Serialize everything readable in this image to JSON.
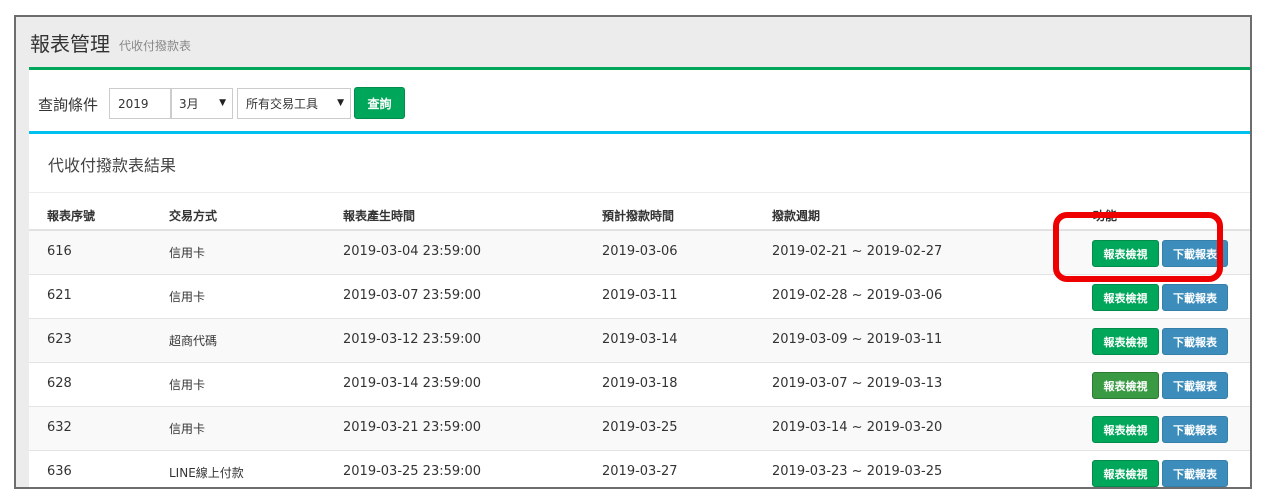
{
  "header": {
    "title": "報表管理",
    "subtitle": "代收付撥款表"
  },
  "query": {
    "label": "查詢條件",
    "year": "2019",
    "month": "3月",
    "tool": "所有交易工具",
    "search_label": "查詢"
  },
  "result": {
    "title": "代收付撥款表結果",
    "columns": [
      "報表序號",
      "交易方式",
      "報表產生時間",
      "預計撥款時間",
      "撥款週期",
      "功能"
    ],
    "view_label": "報表檢視",
    "download_label": "下載報表",
    "rows": [
      {
        "id": "616",
        "method": "信用卡",
        "generated": "2019-03-04 23:59:00",
        "payout": "2019-03-06",
        "period": "2019-02-21 ~ 2019-02-27"
      },
      {
        "id": "621",
        "method": "信用卡",
        "generated": "2019-03-07 23:59:00",
        "payout": "2019-03-11",
        "period": "2019-02-28 ~ 2019-03-06"
      },
      {
        "id": "623",
        "method": "超商代碼",
        "generated": "2019-03-12 23:59:00",
        "payout": "2019-03-14",
        "period": "2019-03-09 ~ 2019-03-11"
      },
      {
        "id": "628",
        "method": "信用卡",
        "generated": "2019-03-14 23:59:00",
        "payout": "2019-03-18",
        "period": "2019-03-07 ~ 2019-03-13"
      },
      {
        "id": "632",
        "method": "信用卡",
        "generated": "2019-03-21 23:59:00",
        "payout": "2019-03-25",
        "period": "2019-03-14 ~ 2019-03-20"
      },
      {
        "id": "636",
        "method": "LINE線上付款",
        "generated": "2019-03-25 23:59:00",
        "payout": "2019-03-27",
        "period": "2019-03-23 ~ 2019-03-25"
      }
    ]
  },
  "colors": {
    "green": "#00a65a",
    "blue": "#3c8dbc",
    "cyan": "#00c0ef",
    "highlight": "#ee0000"
  }
}
